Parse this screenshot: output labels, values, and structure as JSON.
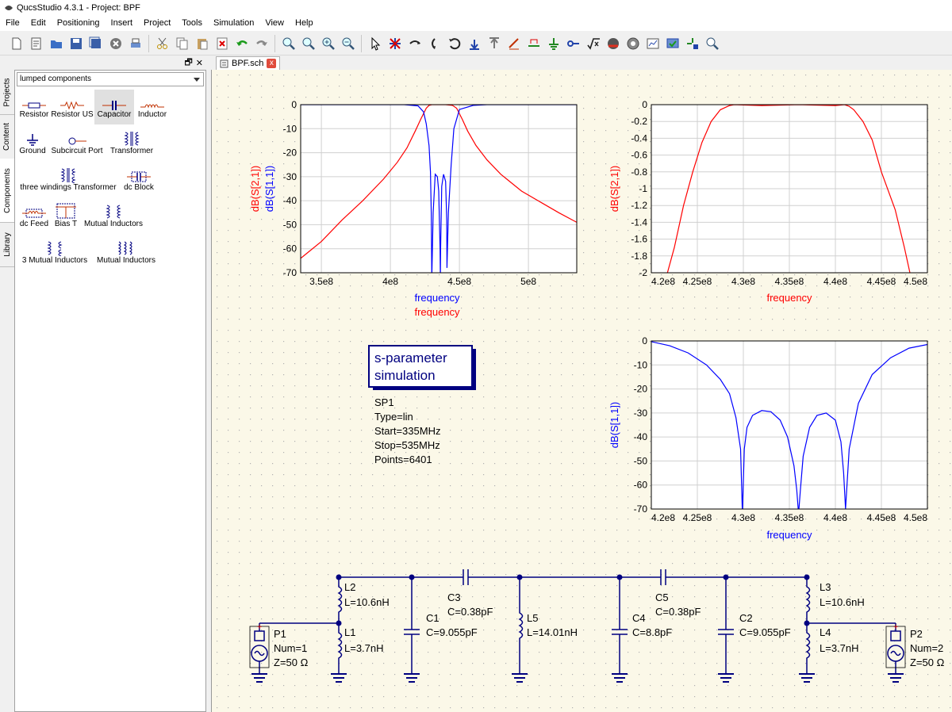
{
  "window": {
    "title": "QucsStudio 4.3.1 - Project: BPF"
  },
  "menu": [
    "File",
    "Edit",
    "Positioning",
    "Insert",
    "Project",
    "Tools",
    "Simulation",
    "View",
    "Help"
  ],
  "side_tabs": [
    "Projects",
    "Content",
    "Components",
    "Library"
  ],
  "dock": {
    "float_glyph": "🗗",
    "close_glyph": "✕"
  },
  "components_panel": {
    "category": "lumped components",
    "items": [
      "Resistor",
      "Resistor US",
      "Capacitor",
      "Inductor",
      "Ground",
      "Subcircuit Port",
      "Transformer",
      "three windings Transformer",
      "dc Block",
      "dc Feed",
      "Bias T",
      "Mutual Inductors",
      "3 Mutual Inductors",
      "Mutual Inductors"
    ],
    "selected": "Capacitor"
  },
  "document_tab": {
    "name": "BPF.sch",
    "close": "x"
  },
  "colors": {
    "canvas_bg": "#fbf8e8",
    "wire": "#000080",
    "trace_red": "#ff0000",
    "trace_blue": "#0000ff",
    "grid_dot": "#b0b0b0"
  },
  "simulation_block": {
    "title_line1": "s-parameter",
    "title_line2": "simulation",
    "name": "SP1",
    "type": "Type=lin",
    "start": "Start=335MHz",
    "stop": "Stop=535MHz",
    "points": "Points=6401"
  },
  "schematic": {
    "L2": {
      "name": "L2",
      "value": "L=10.6nH"
    },
    "L1": {
      "name": "L1",
      "value": "L=3.7nH"
    },
    "C3": {
      "name": "C3",
      "value": "C=0.38pF"
    },
    "C1": {
      "name": "C1",
      "value": "C=9.055pF"
    },
    "L5": {
      "name": "L5",
      "value": "L=14.01nH"
    },
    "C5": {
      "name": "C5",
      "value": "C=0.38pF"
    },
    "C4": {
      "name": "C4",
      "value": "C=8.8pF"
    },
    "C2": {
      "name": "C2",
      "value": "C=9.055pF"
    },
    "L3": {
      "name": "L3",
      "value": "L=10.6nH"
    },
    "L4": {
      "name": "L4",
      "value": "L=3.7nH"
    },
    "P1": {
      "name": "P1",
      "num": "Num=1",
      "z": "Z=50 Ω"
    },
    "P2": {
      "name": "P2",
      "num": "Num=2",
      "z": "Z=50 Ω"
    }
  },
  "chart_data": [
    {
      "type": "line",
      "title": "",
      "xlabel": "frequency",
      "ylabel": "dB(S[2,1]) dB(S[1,1])",
      "xlim": [
        335000000,
        535000000
      ],
      "ylim": [
        -70,
        0
      ],
      "xticks": [
        "3.5e8",
        "4e8",
        "4.5e8",
        "5e8"
      ],
      "yticks": [
        "0",
        "-10",
        "-20",
        "-30",
        "-40",
        "-50",
        "-60",
        "-70"
      ],
      "grid": true,
      "series": [
        {
          "name": "dB(S[2,1])",
          "color": "#ff0000",
          "x": [
            335000000,
            350000000,
            365000000,
            380000000,
            395000000,
            405000000,
            412000000,
            418000000,
            422000000,
            426000000,
            428000000,
            430000000,
            440000000,
            445000000,
            448000000,
            452000000,
            456000000,
            462000000,
            470000000,
            480000000,
            495000000,
            510000000,
            522000000,
            535000000
          ],
          "y": [
            -64,
            -57,
            -48,
            -40,
            -31,
            -24,
            -18,
            -11,
            -6,
            -1.5,
            -0.3,
            0,
            0,
            -0.3,
            -1.5,
            -6,
            -11,
            -17,
            -23,
            -29,
            -36,
            -41,
            -45,
            -49
          ]
        },
        {
          "name": "dB(S[1,1])",
          "color": "#0000ff",
          "x": [
            335000000,
            410000000,
            420000000,
            424000000,
            426000000,
            428000000,
            429000000,
            429600000,
            430000000,
            431000000,
            432500000,
            434000000,
            435000000,
            436000000,
            436200000,
            436400000,
            437200000,
            438500000,
            440000000,
            440800000,
            441000000,
            442000000,
            444000000,
            446000000,
            450000000,
            460000000,
            470000000,
            535000000
          ],
          "y": [
            0,
            0,
            -0.5,
            -3,
            -8,
            -17,
            -28,
            -45,
            -72,
            -45,
            -29,
            -30,
            -36,
            -60,
            -72,
            -60,
            -34,
            -29,
            -32,
            -48,
            -68,
            -45,
            -25,
            -10,
            -2,
            -0.3,
            0,
            0
          ]
        }
      ]
    },
    {
      "type": "line",
      "title": "",
      "xlabel": "frequency",
      "ylabel": "dB(S[2,1])",
      "xlim": [
        420000000,
        450000000
      ],
      "ylim": [
        -2,
        0
      ],
      "xticks": [
        "4.2e8",
        "4.25e8",
        "4.3e8",
        "4.35e8",
        "4.4e8",
        "4.45e8",
        "4.5e8"
      ],
      "yticks": [
        "0",
        "-0.2",
        "-0.4",
        "-0.6",
        "-0.8",
        "-1",
        "-1.2",
        "-1.4",
        "-1.6",
        "-1.8",
        "-2"
      ],
      "grid": true,
      "series": [
        {
          "name": "dB(S[2,1])",
          "color": "#ff0000",
          "x": [
            421000000,
            422500000,
            423500000,
            424500000,
            425500000,
            426500000,
            427500000,
            428500000,
            429000000,
            432000000,
            436000000,
            440000000,
            441000000,
            441500000,
            442000000,
            443000000,
            444000000,
            445000000,
            446500000,
            447500000,
            448200000
          ],
          "y": [
            -2.3,
            -1.7,
            -1.2,
            -0.8,
            -0.45,
            -0.2,
            -0.06,
            -0.01,
            0,
            -0.01,
            0,
            -0.01,
            0,
            -0.02,
            -0.06,
            -0.2,
            -0.42,
            -0.8,
            -1.25,
            -1.7,
            -2.05
          ]
        }
      ]
    },
    {
      "type": "line",
      "title": "",
      "xlabel": "frequency",
      "ylabel": "dB(S[1,1])",
      "xlim": [
        420000000,
        450000000
      ],
      "ylim": [
        -70,
        0
      ],
      "xticks": [
        "4.2e8",
        "4.25e8",
        "4.3e8",
        "4.35e8",
        "4.4e8",
        "4.45e8",
        "4.5e8"
      ],
      "yticks": [
        "0",
        "-10",
        "-20",
        "-30",
        "-40",
        "-50",
        "-60",
        "-70"
      ],
      "grid": true,
      "series": [
        {
          "name": "dB(S[1,1])",
          "color": "#0000ff",
          "x": [
            420000000,
            422000000,
            424000000,
            426000000,
            427500000,
            428500000,
            429200000,
            429700000,
            429900000,
            430100000,
            430400000,
            431000000,
            432000000,
            433000000,
            434000000,
            434800000,
            435500000,
            435800000,
            436000000,
            436200000,
            436500000,
            437200000,
            438000000,
            439000000,
            440000000,
            440600000,
            440900000,
            441100000,
            441500000,
            442500000,
            444000000,
            446000000,
            448000000,
            450000000
          ],
          "y": [
            -0.3,
            -2,
            -5,
            -10,
            -16,
            -22,
            -32,
            -45,
            -72,
            -45,
            -36,
            -31,
            -29,
            -29.5,
            -33,
            -40,
            -52,
            -62,
            -72,
            -62,
            -48,
            -36,
            -31,
            -30,
            -33,
            -42,
            -55,
            -70,
            -45,
            -26,
            -14,
            -7,
            -3,
            -1.5
          ]
        }
      ]
    }
  ]
}
